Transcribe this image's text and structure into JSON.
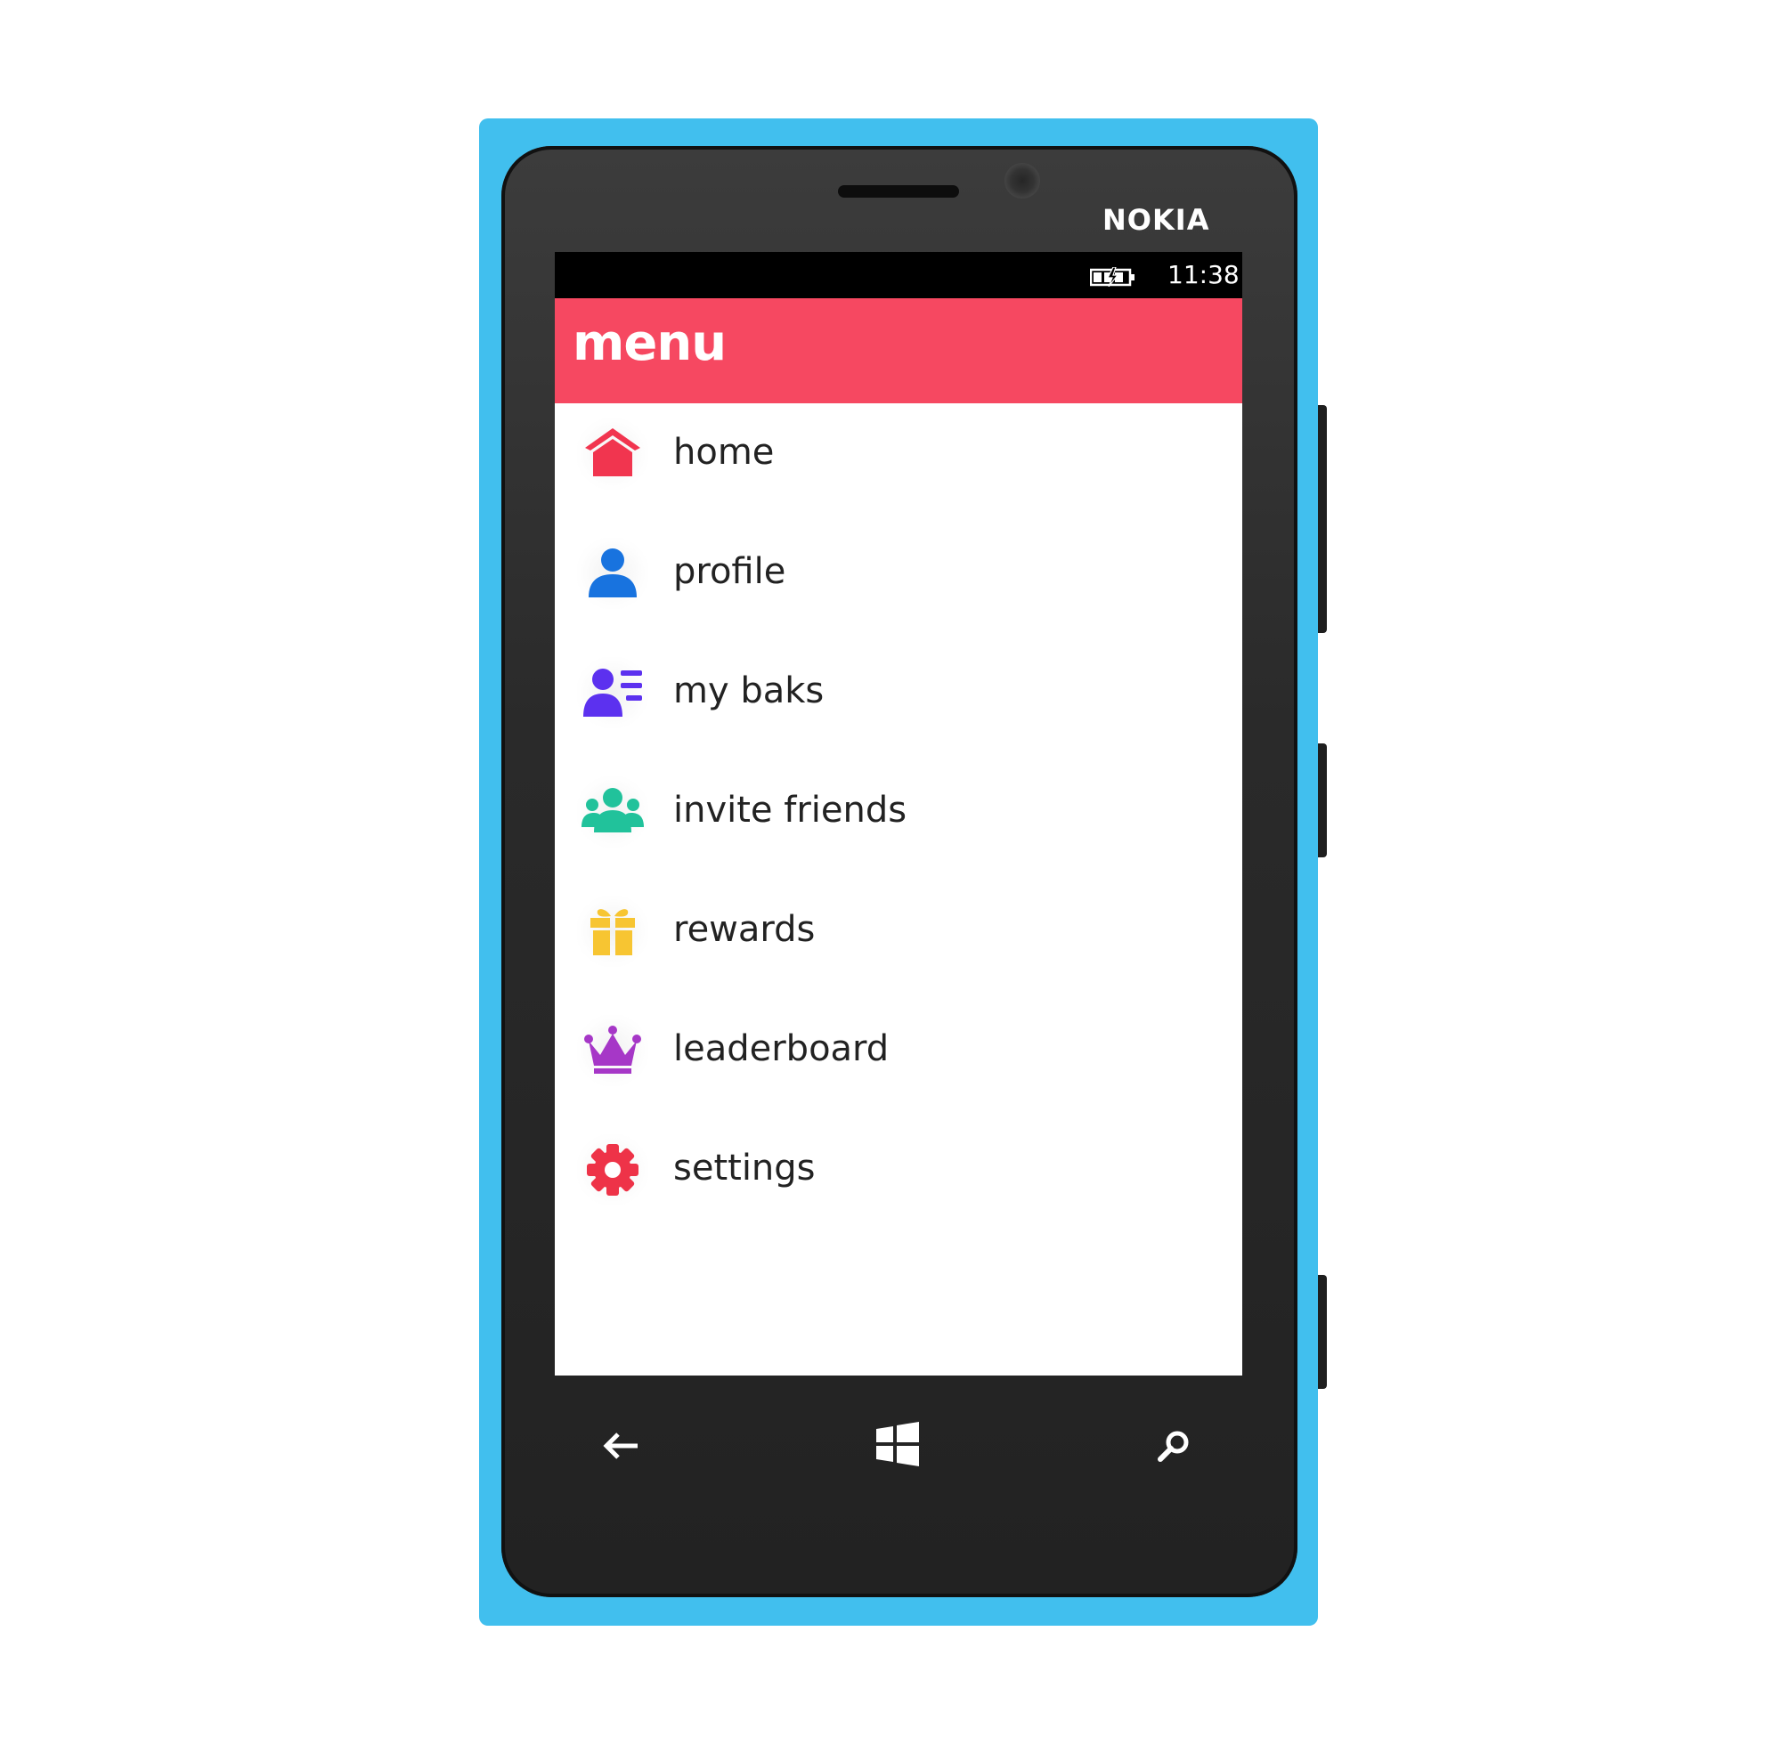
{
  "device": {
    "brand": "NOKIA",
    "body_color": "#41bfee"
  },
  "status_bar": {
    "time": "11:38",
    "battery_icon": "battery-charging-icon"
  },
  "app": {
    "title": "menu",
    "accent_color": "#f64861"
  },
  "menu": {
    "items": [
      {
        "label": "home",
        "icon": "home-icon",
        "color": "#f1354f"
      },
      {
        "label": "profile",
        "icon": "user-icon",
        "color": "#1873df"
      },
      {
        "label": "my baks",
        "icon": "user-list-icon",
        "color": "#5c31ef"
      },
      {
        "label": "invite friends",
        "icon": "group-icon",
        "color": "#21c29b"
      },
      {
        "label": "rewards",
        "icon": "gift-icon",
        "color": "#f7c532"
      },
      {
        "label": "leaderboard",
        "icon": "crown-icon",
        "color": "#a637c7"
      },
      {
        "label": "settings",
        "icon": "gear-icon",
        "color": "#ee3348"
      }
    ]
  },
  "nav_bar": {
    "back_icon": "back-arrow-icon",
    "start_icon": "windows-logo-icon",
    "search_icon": "search-icon"
  }
}
